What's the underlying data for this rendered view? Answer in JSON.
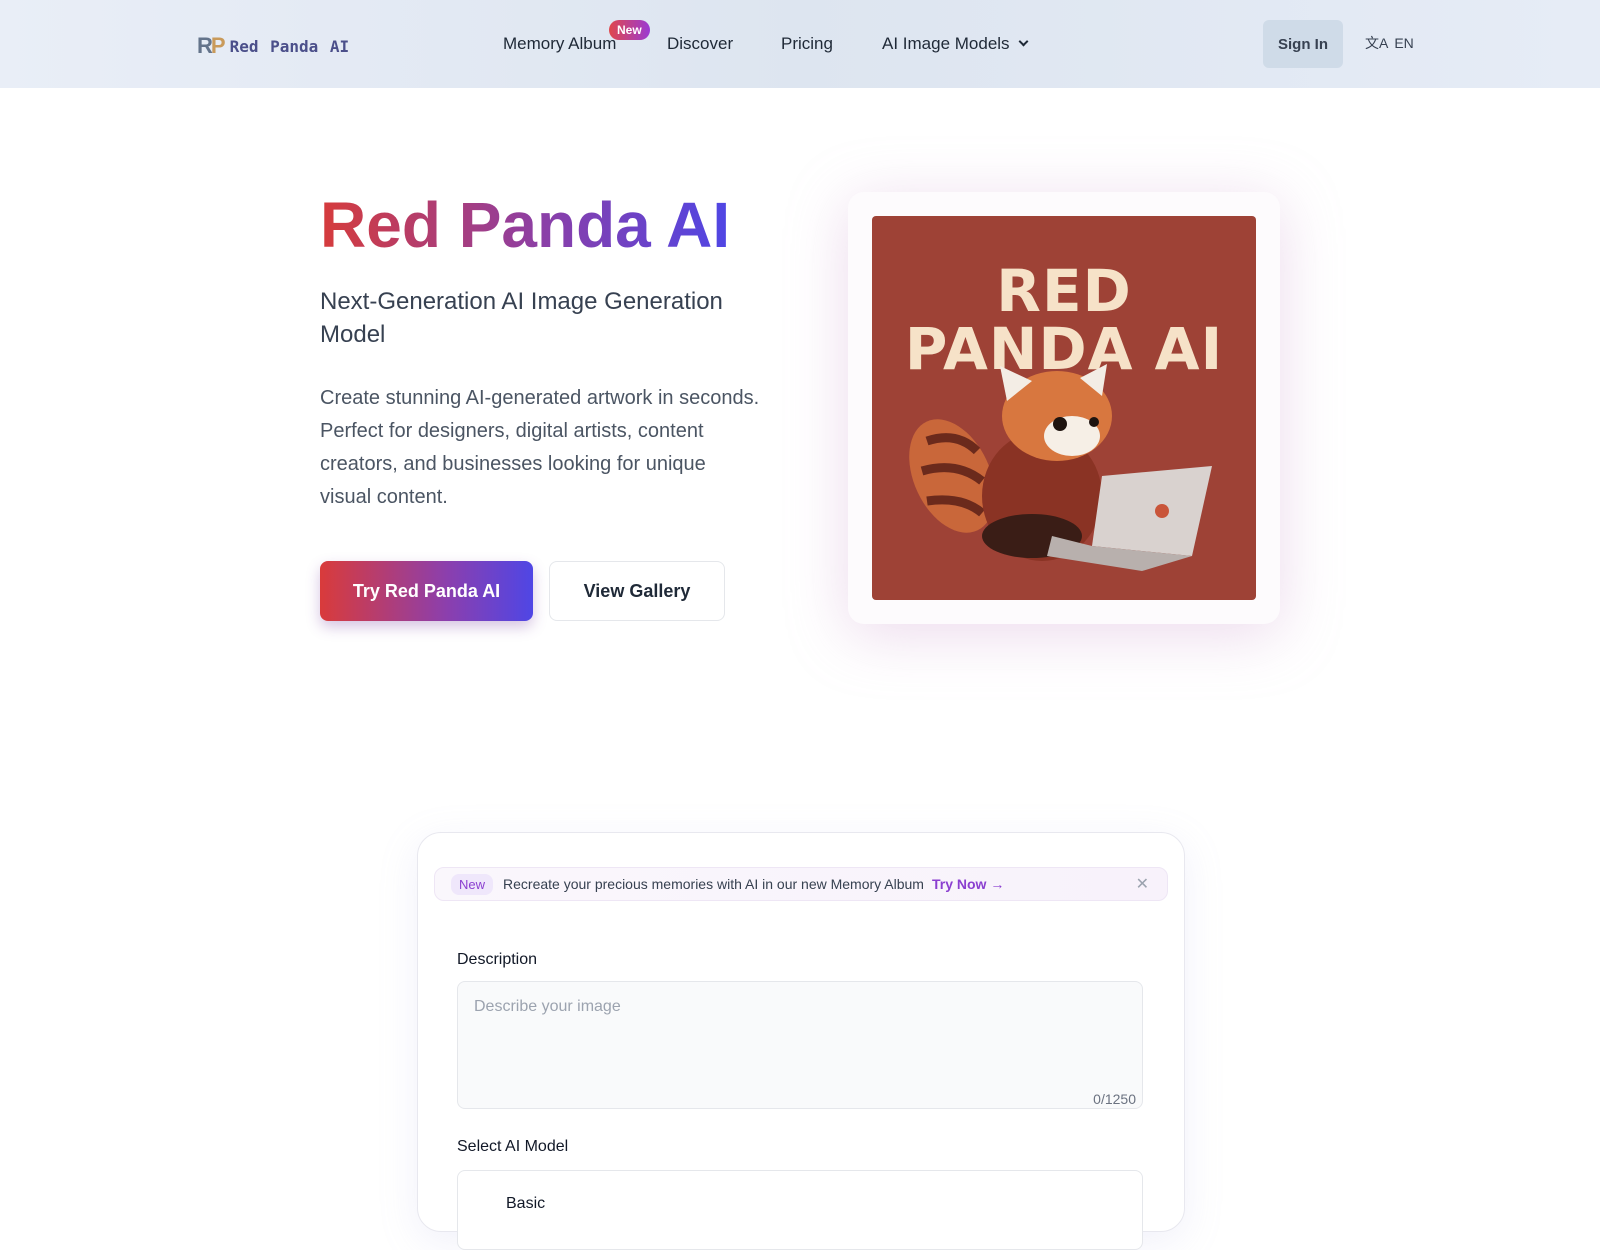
{
  "nav": {
    "logo_mark": "RP",
    "logo_text": "Red Panda AI",
    "items": [
      {
        "label": "Memory Album",
        "badge": "New"
      },
      {
        "label": "Discover"
      },
      {
        "label": "Pricing"
      },
      {
        "label": "AI Image Models"
      }
    ],
    "sign_in": "Sign In",
    "language": "EN"
  },
  "hero": {
    "title": "Red Panda AI",
    "subtitle": "Next-Generation AI Image Generation Model",
    "description": "Create stunning AI-generated artwork in seconds. Perfect for designers, digital artists, content creators, and businesses looking for unique visual content.",
    "primary_button": "Try Red Panda AI",
    "secondary_button": "View Gallery",
    "image_lettering": "RED PANDA AI"
  },
  "generator": {
    "banner": {
      "tag": "New",
      "text": "Recreate your precious memories with AI in our new Memory Album",
      "cta": "Try Now →"
    },
    "description_label": "Description",
    "description_placeholder": "Describe your image",
    "char_count": "0/1250",
    "model_label": "Select AI Model",
    "model_option": "Basic"
  },
  "colors": {
    "brand_red": "#d63b3b",
    "brand_purple": "#8b3fd0",
    "brand_indigo": "#4f46e5"
  }
}
